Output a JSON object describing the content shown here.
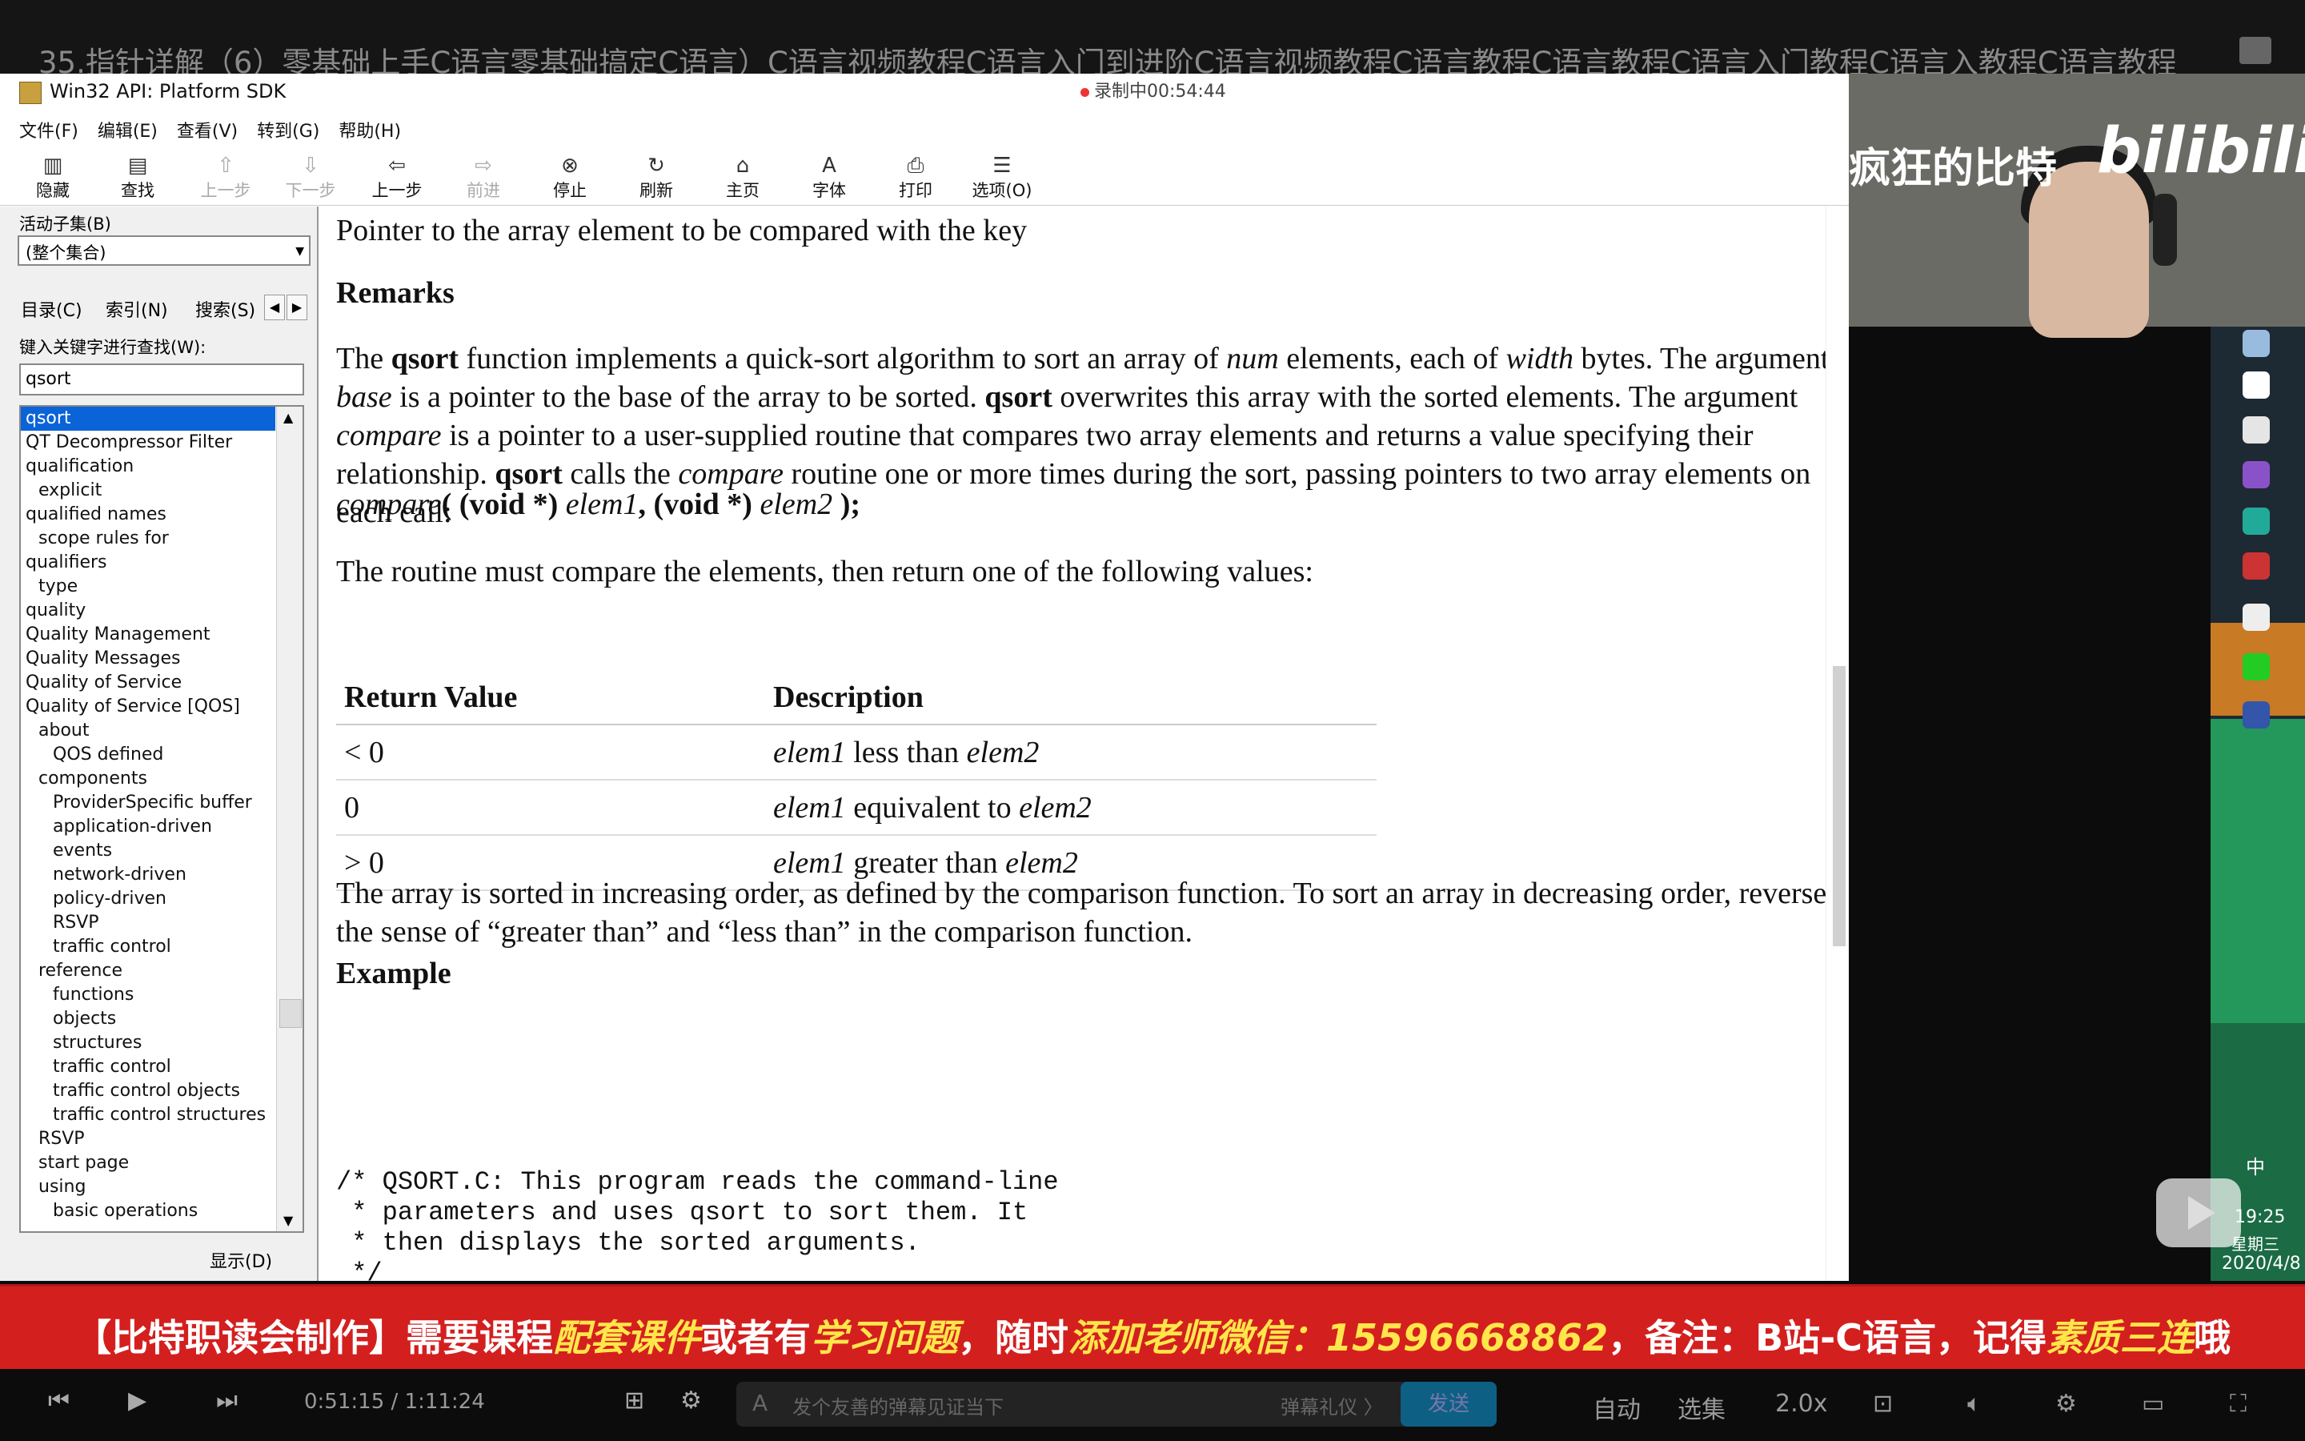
{
  "video": {
    "title": "35.指针详解（6）零基础上手C语言零基础搞定C语言）C语言视频教程C语言入门到进阶C语言视频教程C语言教程C语言教程C语言入门教程C语言入教程C语言教程"
  },
  "window": {
    "title": "Win32 API: Platform SDK",
    "recording": "录制中00:54:44",
    "menu": [
      "文件(F)",
      "编辑(E)",
      "查看(V)",
      "转到(G)",
      "帮助(H)"
    ],
    "toolbar": [
      {
        "label": "隐藏",
        "icon": "hide-icon",
        "glyph": "▥",
        "enabled": true
      },
      {
        "label": "查找",
        "icon": "find-icon",
        "glyph": "▤",
        "enabled": true
      },
      {
        "label": "上一步",
        "icon": "up-arrow-icon",
        "glyph": "⇧",
        "enabled": false
      },
      {
        "label": "下一步",
        "icon": "down-arrow-icon",
        "glyph": "⇩",
        "enabled": false
      },
      {
        "label": "上一步",
        "icon": "back-arrow-icon",
        "glyph": "⇦",
        "enabled": true
      },
      {
        "label": "前进",
        "icon": "forward-arrow-icon",
        "glyph": "⇨",
        "enabled": false
      },
      {
        "label": "停止",
        "icon": "stop-icon",
        "glyph": "⊗",
        "enabled": true
      },
      {
        "label": "刷新",
        "icon": "refresh-icon",
        "glyph": "↻",
        "enabled": true
      },
      {
        "label": "主页",
        "icon": "home-icon",
        "glyph": "⌂",
        "enabled": true
      },
      {
        "label": "字体",
        "icon": "font-icon",
        "glyph": "A",
        "enabled": true
      },
      {
        "label": "打印",
        "icon": "print-icon",
        "glyph": "⎙",
        "enabled": true
      },
      {
        "label": "选项(O)",
        "icon": "options-icon",
        "glyph": "☰",
        "enabled": true
      }
    ]
  },
  "sidebar": {
    "subset_label": "活动子集(B)",
    "subset_value": "(整个集合)",
    "tabs": [
      "目录(C)",
      "索引(N)",
      "搜索(S)"
    ],
    "keyword_label": "键入关键字进行查找(W):",
    "keyword_value": "qsort",
    "display_button": "显示(D)",
    "index_items": [
      {
        "text": "qsort",
        "level": 0,
        "selected": true
      },
      {
        "text": "QT Decompressor Filter",
        "level": 0
      },
      {
        "text": "qualification",
        "level": 0
      },
      {
        "text": "explicit",
        "level": 1
      },
      {
        "text": "qualified names",
        "level": 0
      },
      {
        "text": "scope rules for",
        "level": 1
      },
      {
        "text": "qualifiers",
        "level": 0
      },
      {
        "text": "type",
        "level": 1
      },
      {
        "text": "quality",
        "level": 0
      },
      {
        "text": "Quality Management",
        "level": 0
      },
      {
        "text": "Quality Messages",
        "level": 0
      },
      {
        "text": "Quality of Service",
        "level": 0
      },
      {
        "text": "Quality of Service [QOS]",
        "level": 0
      },
      {
        "text": "about",
        "level": 1
      },
      {
        "text": "QOS defined",
        "level": 2
      },
      {
        "text": "components",
        "level": 1
      },
      {
        "text": "ProviderSpecific buffer",
        "level": 2
      },
      {
        "text": "application-driven",
        "level": 2
      },
      {
        "text": "events",
        "level": 2
      },
      {
        "text": "network-driven",
        "level": 2
      },
      {
        "text": "policy-driven",
        "level": 2
      },
      {
        "text": "RSVP",
        "level": 2
      },
      {
        "text": "traffic control",
        "level": 2
      },
      {
        "text": "reference",
        "level": 1
      },
      {
        "text": "functions",
        "level": 2
      },
      {
        "text": "objects",
        "level": 2
      },
      {
        "text": "structures",
        "level": 2
      },
      {
        "text": "traffic control",
        "level": 2
      },
      {
        "text": "traffic control objects",
        "level": 2
      },
      {
        "text": "traffic control structures",
        "level": 2
      },
      {
        "text": "RSVP",
        "level": 1
      },
      {
        "text": "start page",
        "level": 1
      },
      {
        "text": "using",
        "level": 1
      },
      {
        "text": "basic operations",
        "level": 2
      }
    ]
  },
  "content": {
    "intro": "Pointer to the array element to be compared with the key",
    "remarks_heading": "Remarks",
    "remarks_html": "The <b>qsort</b> function implements a quick-sort algorithm to sort an array of <i>num</i> elements, each of <i>width</i> bytes. The argument <i>base</i> is a pointer to the base of the array to be sorted. <b>qsort</b> overwrites this array with the sorted elements. The argument <i>compare</i> is a pointer to a user-supplied routine that compares two array elements and returns a value specifying their relationship. <b>qsort</b> calls the <i>compare</i> routine one or more times during the sort, passing pointers to two array elements on each call:",
    "signature_html": "<i>compare</i><b>( (void *)</b> <i>elem1</i><b>, (void *)</b> <i>elem2</i> <b>);</b>",
    "routine_text": "The routine must compare the elements, then return one of the following values:",
    "table_headers": [
      "Return Value",
      "Description"
    ],
    "table_rows": [
      {
        "value": "< 0",
        "desc_html": "<i>elem1</i> less than <i>elem2</i>"
      },
      {
        "value": "0",
        "desc_html": "<i>elem1</i> equivalent to <i>elem2</i>"
      },
      {
        "value": "> 0",
        "desc_html": "<i>elem1</i> greater than <i>elem2</i>"
      }
    ],
    "sorted_text": "The array is sorted in increasing order, as defined by the comparison function. To sort an array in decreasing order, reverse the sense of “greater than” and “less than” in the comparison function.",
    "example_heading": "Example",
    "code": "/* QSORT.C: This program reads the command-line\n * parameters and uses qsort to sort them. It\n * then displays the sorted arguments.\n */\n\n#include <stdlib.h>"
  },
  "webcam": {
    "uploader": "疯狂的比特",
    "logo": "bilibili"
  },
  "taskbar": {
    "time": "19:25",
    "day": "星期三",
    "date": "2020/4/8",
    "lang": "中",
    "icons": [
      "app-icon",
      "notes-icon",
      "chrome-icon",
      "visual-studio-icon",
      "network-icon",
      "media-icon",
      "qq-icon",
      "wechat-icon",
      "browser-icon"
    ]
  },
  "banner": {
    "parts": [
      {
        "text": "【比特职读会制作】需要课程",
        "yellow": false
      },
      {
        "text": "配套课件",
        "yellow": true
      },
      {
        "text": "或者有",
        "yellow": false
      },
      {
        "text": "学习问题",
        "yellow": true
      },
      {
        "text": "，随时",
        "yellow": false
      },
      {
        "text": "添加老师微信：15596668862",
        "yellow": true
      },
      {
        "text": "，备注：B站-C语言，记得",
        "yellow": false
      },
      {
        "text": "素质三连",
        "yellow": true
      },
      {
        "text": "哦",
        "yellow": false
      }
    ]
  },
  "player": {
    "time_current": "0:51:15",
    "time_total": "1:11:24",
    "danmaku_placeholder": "发个友善的弹幕见证当下",
    "gift_label": "弹幕礼仪 〉",
    "send": "发送",
    "auto": "自动",
    "episodes": "选集",
    "speed": "2.0x"
  }
}
